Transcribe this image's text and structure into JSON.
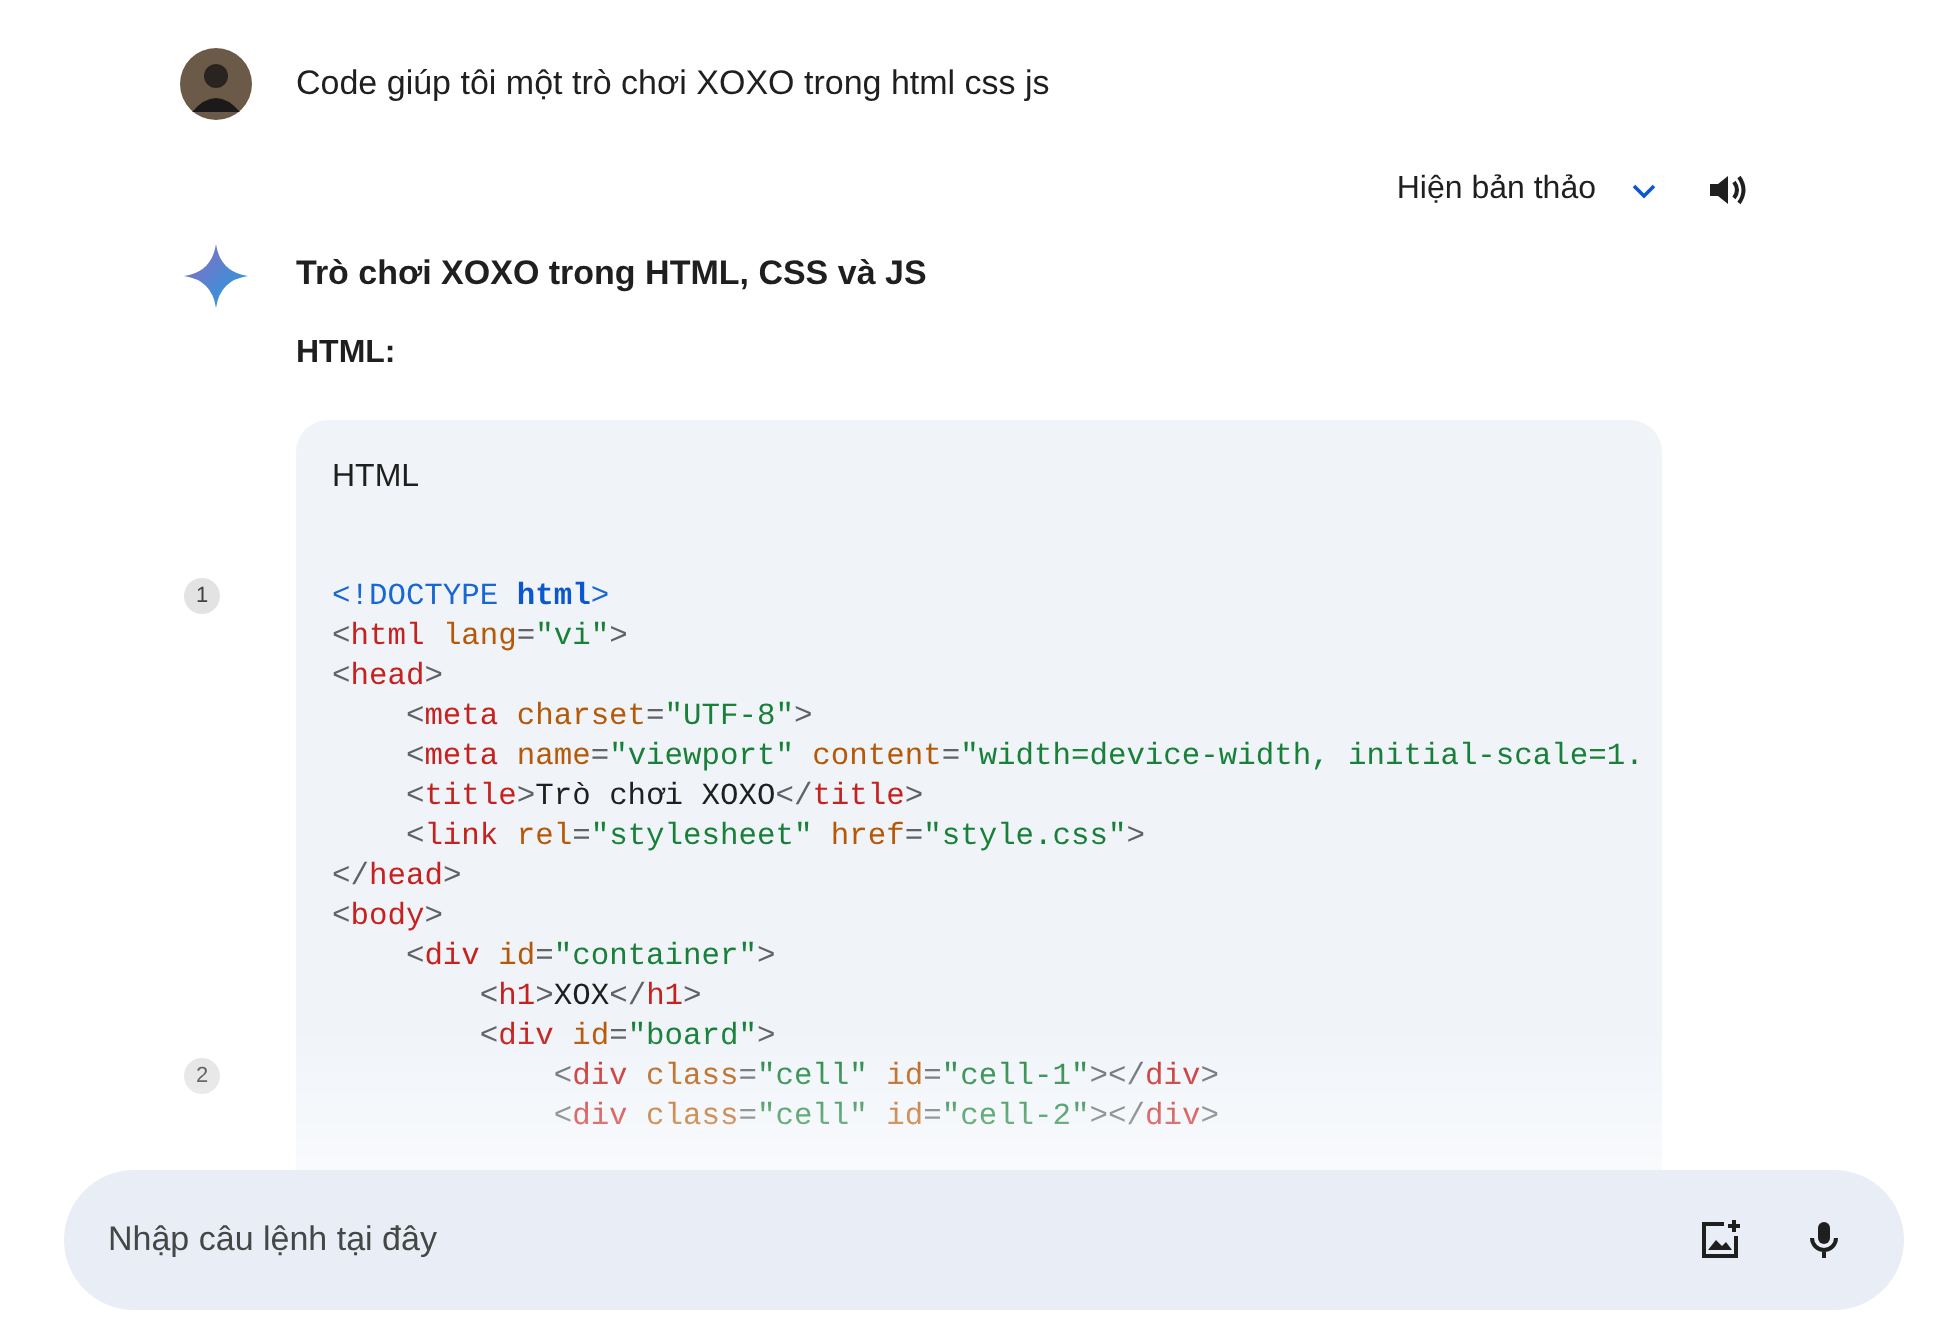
{
  "prompt": {
    "text": "Code giúp tôi một trò chơi XOXO trong html css js"
  },
  "response_bar": {
    "drafts_label": "Hiện bản thảo"
  },
  "response": {
    "title": "Trò chơi XOXO trong HTML, CSS và JS",
    "section": "HTML:",
    "code_block": {
      "language": "HTML",
      "lines": [
        {
          "marker": "1",
          "tokens": [
            {
              "kind": "doctype",
              "text": "<!DOCTYPE "
            },
            {
              "kind": "keyword",
              "text": "html"
            },
            {
              "kind": "doctype",
              "text": ">"
            }
          ]
        },
        {
          "tokens": [
            {
              "kind": "punct",
              "text": "<"
            },
            {
              "kind": "tag",
              "text": "html"
            },
            {
              "kind": "attr",
              "text": " lang"
            },
            {
              "kind": "punct",
              "text": "="
            },
            {
              "kind": "string",
              "text": "\"vi\""
            },
            {
              "kind": "punct",
              "text": ">"
            }
          ]
        },
        {
          "tokens": [
            {
              "kind": "punct",
              "text": "<"
            },
            {
              "kind": "tag",
              "text": "head"
            },
            {
              "kind": "punct",
              "text": ">"
            }
          ]
        },
        {
          "tokens": [
            {
              "kind": "punct",
              "text": "    <"
            },
            {
              "kind": "tag",
              "text": "meta"
            },
            {
              "kind": "attr",
              "text": " charset"
            },
            {
              "kind": "punct",
              "text": "="
            },
            {
              "kind": "string",
              "text": "\"UTF-8\""
            },
            {
              "kind": "punct",
              "text": ">"
            }
          ]
        },
        {
          "tokens": [
            {
              "kind": "punct",
              "text": "    <"
            },
            {
              "kind": "tag",
              "text": "meta"
            },
            {
              "kind": "attr",
              "text": " name"
            },
            {
              "kind": "punct",
              "text": "="
            },
            {
              "kind": "string",
              "text": "\"viewport\""
            },
            {
              "kind": "attr",
              "text": " content"
            },
            {
              "kind": "punct",
              "text": "="
            },
            {
              "kind": "string",
              "text": "\"width=device-width, initial-scale=1."
            }
          ]
        },
        {
          "tokens": [
            {
              "kind": "punct",
              "text": "    <"
            },
            {
              "kind": "tag",
              "text": "title"
            },
            {
              "kind": "punct",
              "text": ">"
            },
            {
              "kind": "text",
              "text": "Trò chơi XOXO"
            },
            {
              "kind": "punct",
              "text": "</"
            },
            {
              "kind": "tag",
              "text": "title"
            },
            {
              "kind": "punct",
              "text": ">"
            }
          ]
        },
        {
          "tokens": [
            {
              "kind": "punct",
              "text": "    <"
            },
            {
              "kind": "tag",
              "text": "link"
            },
            {
              "kind": "attr",
              "text": " rel"
            },
            {
              "kind": "punct",
              "text": "="
            },
            {
              "kind": "string",
              "text": "\"stylesheet\""
            },
            {
              "kind": "attr",
              "text": " href"
            },
            {
              "kind": "punct",
              "text": "="
            },
            {
              "kind": "string",
              "text": "\"style.css\""
            },
            {
              "kind": "punct",
              "text": ">"
            }
          ]
        },
        {
          "tokens": [
            {
              "kind": "punct",
              "text": "</"
            },
            {
              "kind": "tag",
              "text": "head"
            },
            {
              "kind": "punct",
              "text": ">"
            }
          ]
        },
        {
          "tokens": [
            {
              "kind": "punct",
              "text": "<"
            },
            {
              "kind": "tag",
              "text": "body"
            },
            {
              "kind": "punct",
              "text": ">"
            }
          ]
        },
        {
          "tokens": [
            {
              "kind": "punct",
              "text": "    <"
            },
            {
              "kind": "tag",
              "text": "div"
            },
            {
              "kind": "attr",
              "text": " id"
            },
            {
              "kind": "punct",
              "text": "="
            },
            {
              "kind": "string",
              "text": "\"container\""
            },
            {
              "kind": "punct",
              "text": ">"
            }
          ]
        },
        {
          "tokens": [
            {
              "kind": "punct",
              "text": "        <"
            },
            {
              "kind": "tag",
              "text": "h1"
            },
            {
              "kind": "punct",
              "text": ">"
            },
            {
              "kind": "text",
              "text": "XOX"
            },
            {
              "kind": "punct",
              "text": "</"
            },
            {
              "kind": "tag",
              "text": "h1"
            },
            {
              "kind": "punct",
              "text": ">"
            }
          ]
        },
        {
          "tokens": [
            {
              "kind": "punct",
              "text": "        <"
            },
            {
              "kind": "tag",
              "text": "div"
            },
            {
              "kind": "attr",
              "text": " id"
            },
            {
              "kind": "punct",
              "text": "="
            },
            {
              "kind": "string",
              "text": "\"board\""
            },
            {
              "kind": "punct",
              "text": ">"
            }
          ]
        },
        {
          "marker": "2",
          "tokens": [
            {
              "kind": "punct",
              "text": "            <"
            },
            {
              "kind": "tag",
              "text": "div"
            },
            {
              "kind": "attr",
              "text": " class"
            },
            {
              "kind": "punct",
              "text": "="
            },
            {
              "kind": "string",
              "text": "\"cell\""
            },
            {
              "kind": "attr",
              "text": " id"
            },
            {
              "kind": "punct",
              "text": "="
            },
            {
              "kind": "string",
              "text": "\"cell-1\""
            },
            {
              "kind": "punct",
              "text": "></"
            },
            {
              "kind": "tag",
              "text": "div"
            },
            {
              "kind": "punct",
              "text": ">"
            }
          ]
        },
        {
          "tokens": [
            {
              "kind": "punct",
              "text": "            <"
            },
            {
              "kind": "tag",
              "text": "div"
            },
            {
              "kind": "attr",
              "text": " class"
            },
            {
              "kind": "punct",
              "text": "="
            },
            {
              "kind": "string",
              "text": "\"cell\""
            },
            {
              "kind": "attr",
              "text": " id"
            },
            {
              "kind": "punct",
              "text": "="
            },
            {
              "kind": "string",
              "text": "\"cell-2\""
            },
            {
              "kind": "punct",
              "text": "></"
            },
            {
              "kind": "tag",
              "text": "div"
            },
            {
              "kind": "punct",
              "text": ">"
            }
          ]
        }
      ]
    }
  },
  "input": {
    "placeholder": "Nhập câu lệnh tại đây"
  }
}
